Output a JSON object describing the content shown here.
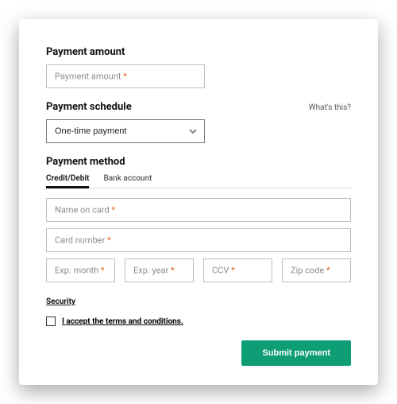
{
  "amount": {
    "title": "Payment amount",
    "placeholder": "Payment amount"
  },
  "schedule": {
    "title": "Payment schedule",
    "helper": "What's this?",
    "selected": "One-time payment"
  },
  "method": {
    "title": "Payment method",
    "tabs": {
      "credit": "Credit/Debit",
      "bank": "Bank account"
    },
    "name_on_card": "Name on card",
    "card_number": "Card number",
    "exp_month": "Exp. month",
    "exp_year": "Exp. year",
    "ccv": "CCV",
    "zip": "Zip code"
  },
  "security_link": "Security",
  "terms_label": "I accept the terms and conditions.",
  "submit_label": "Submit payment",
  "asterisk": "*"
}
